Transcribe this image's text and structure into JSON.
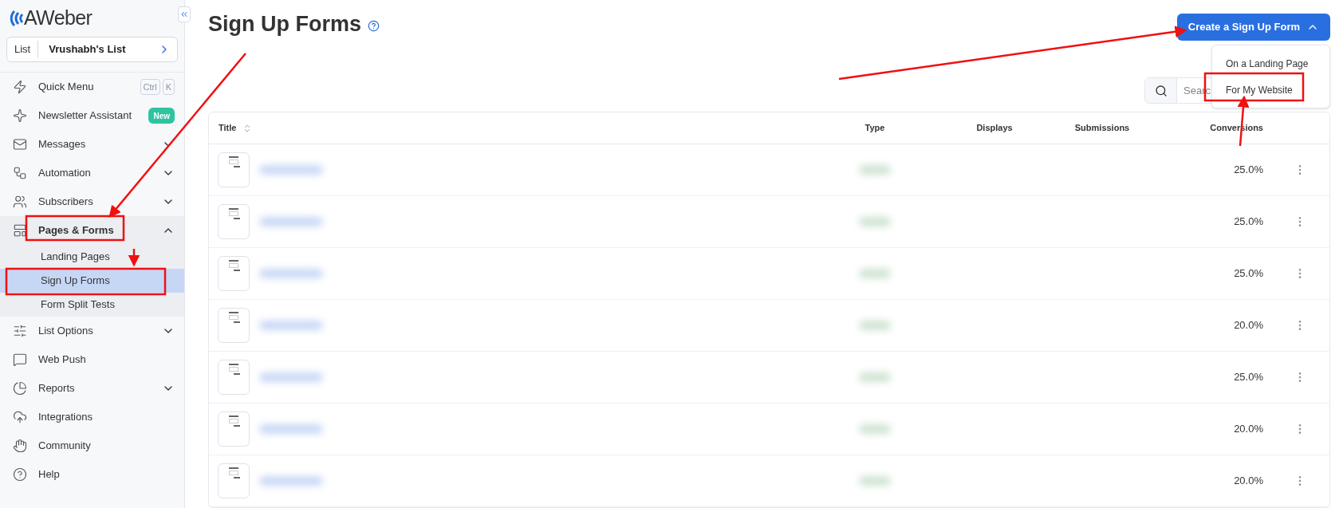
{
  "sidebar": {
    "logo": "AWeber",
    "list_selector": {
      "label": "List",
      "value": "Vrushabh's List"
    },
    "items": [
      {
        "kind": "link",
        "label": "Quick Menu",
        "shortcut": [
          "Ctrl",
          "K"
        ]
      },
      {
        "kind": "link",
        "label": "Newsletter Assistant",
        "badge": "New"
      },
      {
        "kind": "group",
        "label": "Messages",
        "expanded": false
      },
      {
        "kind": "group",
        "label": "Automation",
        "expanded": false
      },
      {
        "kind": "group",
        "label": "Subscribers",
        "expanded": false
      },
      {
        "kind": "group",
        "label": "Pages & Forms",
        "expanded": true,
        "children": [
          {
            "label": "Landing Pages",
            "selected": false
          },
          {
            "label": "Sign Up Forms",
            "selected": true
          },
          {
            "label": "Form Split Tests",
            "selected": false
          }
        ]
      },
      {
        "kind": "group",
        "label": "List Options",
        "expanded": false
      },
      {
        "kind": "link",
        "label": "Web Push"
      },
      {
        "kind": "group",
        "label": "Reports",
        "expanded": false
      },
      {
        "kind": "link",
        "label": "Integrations"
      },
      {
        "kind": "link",
        "label": "Community"
      },
      {
        "kind": "link",
        "label": "Help"
      }
    ]
  },
  "page": {
    "title": "Sign Up Forms",
    "create_button": {
      "label": "Create a Sign Up Form",
      "expanded": true
    },
    "dropdown": [
      "On a Landing Page",
      "For My Website"
    ],
    "search": {
      "placeholder": "Searc"
    }
  },
  "table": {
    "columns": [
      "Title",
      "Type",
      "Displays",
      "Submissions",
      "Conversions"
    ],
    "rows": [
      {
        "conversions": "25.0%"
      },
      {
        "conversions": "25.0%"
      },
      {
        "conversions": "25.0%"
      },
      {
        "conversions": "20.0%"
      },
      {
        "conversions": "25.0%"
      },
      {
        "conversions": "20.0%"
      },
      {
        "conversions": "20.0%"
      }
    ]
  }
}
